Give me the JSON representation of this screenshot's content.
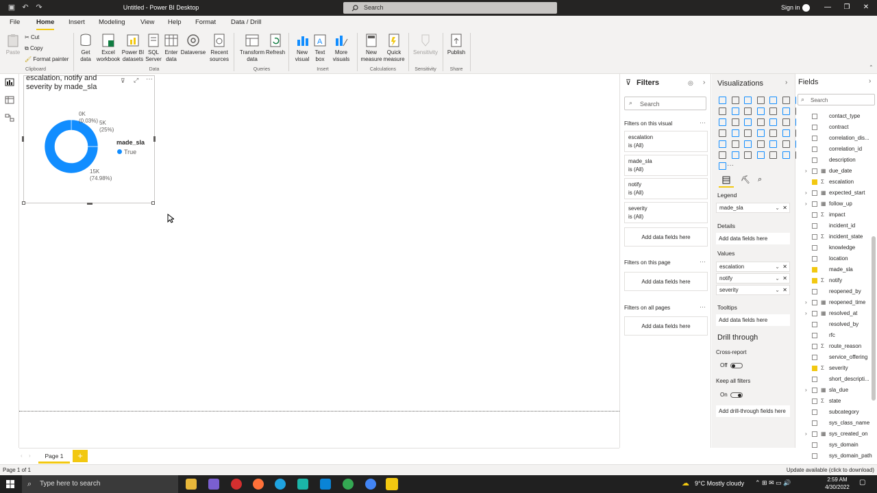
{
  "titlebar": {
    "title": "Untitled - Power BI Desktop",
    "search_placeholder": "Search",
    "signin": "Sign in"
  },
  "menu": {
    "tabs": [
      "File",
      "Home",
      "Insert",
      "Modeling",
      "View",
      "Help",
      "Format",
      "Data / Drill"
    ],
    "active": "Home"
  },
  "ribbon": {
    "clipboard": {
      "paste": "Paste",
      "cut": "Cut",
      "copy": "Copy",
      "format_painter": "Format painter",
      "label": "Clipboard"
    },
    "data": {
      "get_data": "Get data",
      "excel": "Excel workbook",
      "pbi_datasets": "Power BI datasets",
      "sql": "SQL Server",
      "enter_data": "Enter data",
      "dataverse": "Dataverse",
      "recent": "Recent sources",
      "label": "Data"
    },
    "queries": {
      "transform": "Transform data",
      "refresh": "Refresh",
      "label": "Queries"
    },
    "insert": {
      "new_visual": "New visual",
      "text_box": "Text box",
      "more_visuals": "More visuals",
      "label": "Insert"
    },
    "calculations": {
      "new_measure": "New measure",
      "quick_measure": "Quick measure",
      "label": "Calculations"
    },
    "sensitivity": {
      "btn": "Sensitivity",
      "label": "Sensitivity"
    },
    "share": {
      "publish": "Publish",
      "label": "Share"
    }
  },
  "visual": {
    "title": "escalation, notify and severity by made_sla",
    "legend_title": "made_sla",
    "legend_item": "True",
    "labels": [
      {
        "value": "0K",
        "pct": "(0.03%)"
      },
      {
        "value": "5K",
        "pct": "(25%)"
      },
      {
        "value": "15K",
        "pct": "(74.98%)"
      }
    ],
    "accent": "#118dff"
  },
  "chart_data": {
    "type": "pie",
    "title": "escalation, notify and severity by made_sla",
    "legend": [
      "True"
    ],
    "slices": [
      {
        "label": "0K",
        "value": 0.03
      },
      {
        "label": "5K",
        "value": 25
      },
      {
        "label": "15K",
        "value": 74.98
      }
    ]
  },
  "filters": {
    "title": "Filters",
    "search": "Search",
    "on_visual": "Filters on this visual",
    "cards": [
      {
        "name": "escalation",
        "state": "is (All)"
      },
      {
        "name": "made_sla",
        "state": "is (All)"
      },
      {
        "name": "notify",
        "state": "is (All)"
      },
      {
        "name": "severity",
        "state": "is (All)"
      }
    ],
    "add": "Add data fields here",
    "on_page": "Filters on this page",
    "on_all": "Filters on all pages"
  },
  "viz": {
    "title": "Visualizations",
    "legend": "Legend",
    "legend_field": "made_sla",
    "details": "Details",
    "add": "Add data fields here",
    "values": "Values",
    "value_fields": [
      "escalation",
      "notify",
      "severity"
    ],
    "tooltips": "Tooltips",
    "drill": "Drill through",
    "cross": "Cross-report",
    "off": "Off",
    "keep": "Keep all filters",
    "on": "On",
    "drill_add": "Add drill-through fields here"
  },
  "fields": {
    "title": "Fields",
    "search": "Search",
    "items": [
      {
        "name": "contact_type",
        "checked": false,
        "type": "",
        "exp": false
      },
      {
        "name": "contract",
        "checked": false,
        "type": "",
        "exp": false
      },
      {
        "name": "correlation_dis...",
        "checked": false,
        "type": "",
        "exp": false
      },
      {
        "name": "correlation_id",
        "checked": false,
        "type": "",
        "exp": false
      },
      {
        "name": "description",
        "checked": false,
        "type": "",
        "exp": false
      },
      {
        "name": "due_date",
        "checked": false,
        "type": "cal",
        "exp": true
      },
      {
        "name": "escalation",
        "checked": true,
        "type": "sum",
        "exp": false
      },
      {
        "name": "expected_start",
        "checked": false,
        "type": "cal",
        "exp": true
      },
      {
        "name": "follow_up",
        "checked": false,
        "type": "cal",
        "exp": true
      },
      {
        "name": "impact",
        "checked": false,
        "type": "sum",
        "exp": false
      },
      {
        "name": "incident_id",
        "checked": false,
        "type": "",
        "exp": false
      },
      {
        "name": "incident_state",
        "checked": false,
        "type": "sum",
        "exp": false
      },
      {
        "name": "knowledge",
        "checked": false,
        "type": "",
        "exp": false
      },
      {
        "name": "location",
        "checked": false,
        "type": "",
        "exp": false
      },
      {
        "name": "made_sla",
        "checked": true,
        "type": "",
        "exp": false
      },
      {
        "name": "notify",
        "checked": true,
        "type": "sum",
        "exp": false
      },
      {
        "name": "reopened_by",
        "checked": false,
        "type": "",
        "exp": false
      },
      {
        "name": "reopened_time",
        "checked": false,
        "type": "cal",
        "exp": true
      },
      {
        "name": "resolved_at",
        "checked": false,
        "type": "cal",
        "exp": true
      },
      {
        "name": "resolved_by",
        "checked": false,
        "type": "",
        "exp": false
      },
      {
        "name": "rfc",
        "checked": false,
        "type": "",
        "exp": false
      },
      {
        "name": "route_reason",
        "checked": false,
        "type": "sum",
        "exp": false
      },
      {
        "name": "service_offering",
        "checked": false,
        "type": "",
        "exp": false
      },
      {
        "name": "severity",
        "checked": true,
        "type": "sum",
        "exp": false
      },
      {
        "name": "short_descripti...",
        "checked": false,
        "type": "",
        "exp": false
      },
      {
        "name": "sla_due",
        "checked": false,
        "type": "cal",
        "exp": true
      },
      {
        "name": "state",
        "checked": false,
        "type": "sum",
        "exp": false
      },
      {
        "name": "subcategory",
        "checked": false,
        "type": "",
        "exp": false
      },
      {
        "name": "sys_class_name",
        "checked": false,
        "type": "",
        "exp": false
      },
      {
        "name": "sys_created_on",
        "checked": false,
        "type": "cal",
        "exp": true
      },
      {
        "name": "sys_domain",
        "checked": false,
        "type": "",
        "exp": false
      },
      {
        "name": "sys_domain_path",
        "checked": false,
        "type": "",
        "exp": false
      }
    ]
  },
  "page": {
    "tab": "Page 1",
    "status": "Page 1 of 1",
    "update": "Update available (click to download)"
  },
  "taskbar": {
    "search": "Type here to search",
    "weather": "9°C  Mostly cloudy",
    "time": "2:59 AM",
    "date": "4/30/2022"
  }
}
